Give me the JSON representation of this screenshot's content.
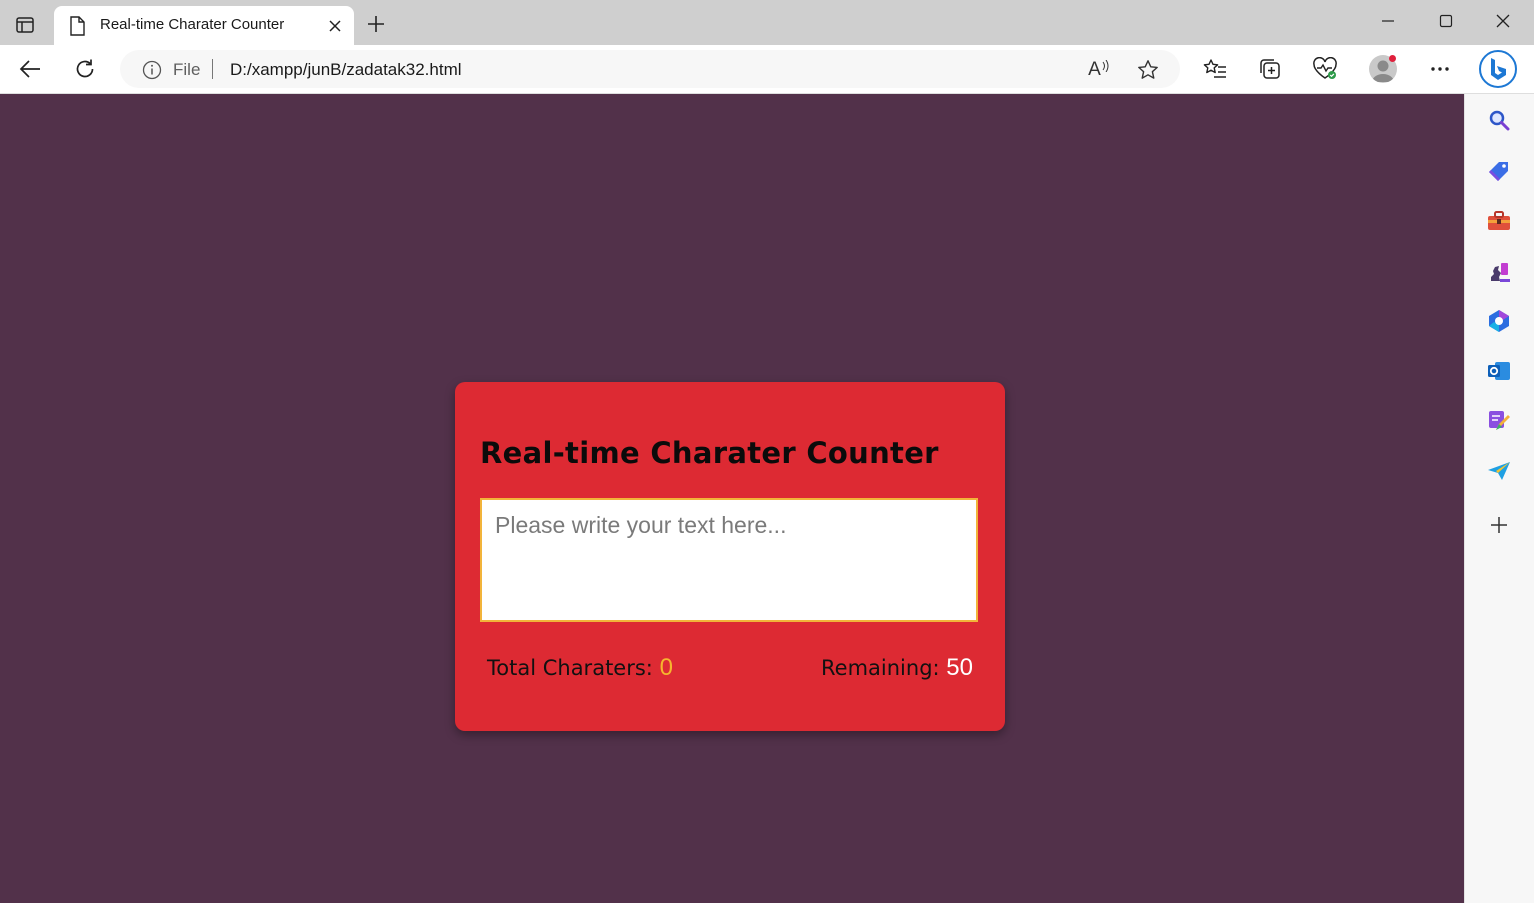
{
  "browser": {
    "tab_title": "Real-time Charater Counter",
    "address_scheme_label": "File",
    "address_url": "D:/xampp/junB/zadatak32.html",
    "read_aloud_label": "A",
    "icons": {
      "tab_actions": "tab-actions-icon",
      "favicon": "document-icon",
      "close": "close-icon",
      "new_tab": "plus-icon",
      "minimize": "minimize-icon",
      "maximize": "maximize-icon",
      "window_close": "close-icon",
      "back": "back-arrow-icon",
      "refresh": "refresh-icon",
      "info": "info-icon",
      "read_aloud": "read-aloud-icon",
      "favorite": "star-icon",
      "favorites": "favorites-list-icon",
      "collections": "collections-icon",
      "browser_essentials": "heart-pulse-icon",
      "profile": "avatar",
      "more": "more-icon",
      "copilot": "copilot-icon"
    }
  },
  "sidebar": {
    "items": [
      {
        "name": "search-icon"
      },
      {
        "name": "shopping-tag-icon"
      },
      {
        "name": "tools-briefcase-icon"
      },
      {
        "name": "games-icon"
      },
      {
        "name": "microsoft-365-icon"
      },
      {
        "name": "outlook-icon"
      },
      {
        "name": "designer-icon"
      },
      {
        "name": "send-icon"
      },
      {
        "name": "add-icon"
      }
    ]
  },
  "page": {
    "background": "#52314a",
    "card": {
      "background": "#dd2a33",
      "title": "Real-time Charater Counter",
      "textarea_placeholder": "Please write your text here...",
      "total_label": "Total Charaters:",
      "total_value": "0",
      "remaining_label": "Remaining:",
      "remaining_value": "50",
      "total_color": "#f6b52e",
      "remaining_color": "#ffffff",
      "border_color": "#f2b43a"
    }
  }
}
